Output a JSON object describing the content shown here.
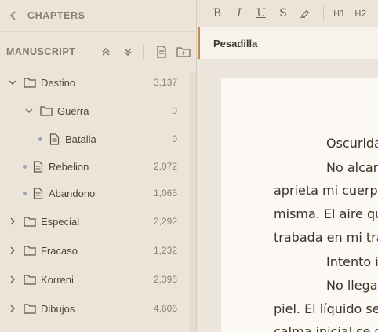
{
  "sidebar": {
    "header": {
      "title": "CHAPTERS"
    },
    "manuscript": {
      "label": "MANUSCRIPT"
    },
    "tree": [
      {
        "name": "Destino",
        "count": "3,137",
        "type": "folder",
        "expanded": true
      },
      {
        "name": "Guerra",
        "count": "0",
        "type": "folder",
        "expanded": true
      },
      {
        "name": "Batalla",
        "count": "0",
        "type": "file"
      },
      {
        "name": "Rebelion",
        "count": "2,072",
        "type": "file"
      },
      {
        "name": "Abandono",
        "count": "1,065",
        "type": "file"
      },
      {
        "name": "Especial",
        "count": "2,292",
        "type": "folder",
        "expanded": false
      },
      {
        "name": "Fracaso",
        "count": "1,232",
        "type": "folder",
        "expanded": false
      },
      {
        "name": "Korreni",
        "count": "2,395",
        "type": "folder",
        "expanded": false
      },
      {
        "name": "Dibujos",
        "count": "4,606",
        "type": "folder",
        "expanded": false
      }
    ]
  },
  "toolbar": {
    "bold": "B",
    "italic": "I",
    "underline": "U",
    "strike": "S",
    "h1": "H1",
    "h2": "H2"
  },
  "document": {
    "title": "Pesadilla",
    "lines": [
      "Oscurida",
      "No alcan",
      "aprieta mi cuerpo",
      "misma. El aire que",
      "trabada en mi trác",
      "Intento i",
      "No llega",
      "piel. El líquido se",
      "calma inicial se de"
    ]
  },
  "colors": {
    "accent": "#c48a52",
    "sidebar_bg": "#ece4d9",
    "paper_bg": "#fcf8f3"
  }
}
